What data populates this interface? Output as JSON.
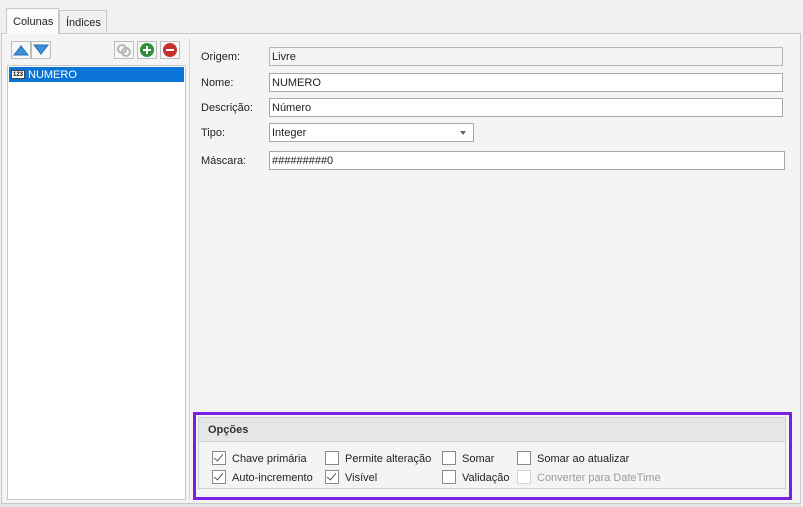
{
  "tabs": [
    {
      "label": "Colunas",
      "active": true
    },
    {
      "label": "Índices",
      "active": false
    }
  ],
  "toolbar": {
    "move_up_icon": "triangle-up-icon",
    "move_down_icon": "triangle-down-icon",
    "link_icon": "link-icon",
    "add_icon": "plus-circle-icon",
    "remove_icon": "minus-circle-icon",
    "colors": {
      "arrow": "#3b8fd9",
      "add": "#2f8f3a",
      "remove": "#c9302c",
      "selection": "#0a74d6",
      "outline": "#7a1fe0"
    }
  },
  "columns": [
    {
      "name": "NUMERO",
      "type_badge": "123",
      "selected": true
    }
  ],
  "form": {
    "origem": {
      "label": "Origem:",
      "value": "Livre"
    },
    "nome": {
      "label": "Nome:",
      "value": "NUMERO"
    },
    "descricao": {
      "label": "Descrição:",
      "value": "Número"
    },
    "tipo": {
      "label": "Tipo:",
      "value": "Integer"
    },
    "mascara": {
      "label": "Máscara:",
      "value": "#########0"
    }
  },
  "options": {
    "title": "Opções",
    "checkboxes": {
      "chave_primaria": {
        "label": "Chave primária",
        "checked": true,
        "enabled": true
      },
      "auto_incremento": {
        "label": "Auto-incremento",
        "checked": true,
        "enabled": true
      },
      "permite_alteracao": {
        "label": "Permite alteração",
        "checked": false,
        "enabled": true
      },
      "visivel": {
        "label": "Visível",
        "checked": true,
        "enabled": true
      },
      "somar": {
        "label": "Somar",
        "checked": false,
        "enabled": true
      },
      "validacao": {
        "label": "Validação",
        "checked": false,
        "enabled": true
      },
      "somar_ao_atualizar": {
        "label": "Somar ao atualizar",
        "checked": false,
        "enabled": true
      },
      "converter_datetime": {
        "label": "Converter para DateTime",
        "checked": false,
        "enabled": false
      }
    }
  }
}
